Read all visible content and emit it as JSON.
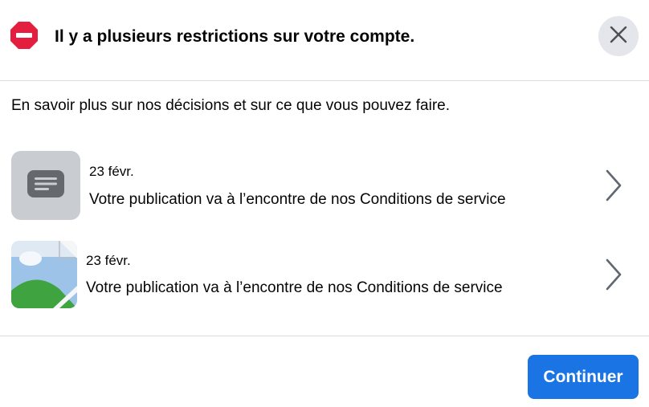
{
  "dialog": {
    "title": "Il y a plusieurs restrictions sur votre compte.",
    "intro": "En savoir plus sur nos décisions et sur ce que vous pouvez faire.",
    "items": [
      {
        "date": "23 févr.",
        "description": "Votre publication va à l’encontre de nos Conditions de service",
        "thumbnail_icon": "document-icon"
      },
      {
        "date": "23 févr.",
        "description": "Votre publication va à l’encontre de nos Conditions de service",
        "thumbnail_icon": "broken-image-icon"
      }
    ],
    "continue_label": "Continuer"
  },
  "icons": {
    "warning": "no-entry-icon",
    "close": "close-icon",
    "chevron": "chevron-right-icon"
  },
  "colors": {
    "accent": "#1b74e4",
    "warning": "#e41e3f",
    "close_bg": "#e4e6eb",
    "thumb_bg": "#c9ccd1",
    "divider": "#dadde1"
  }
}
